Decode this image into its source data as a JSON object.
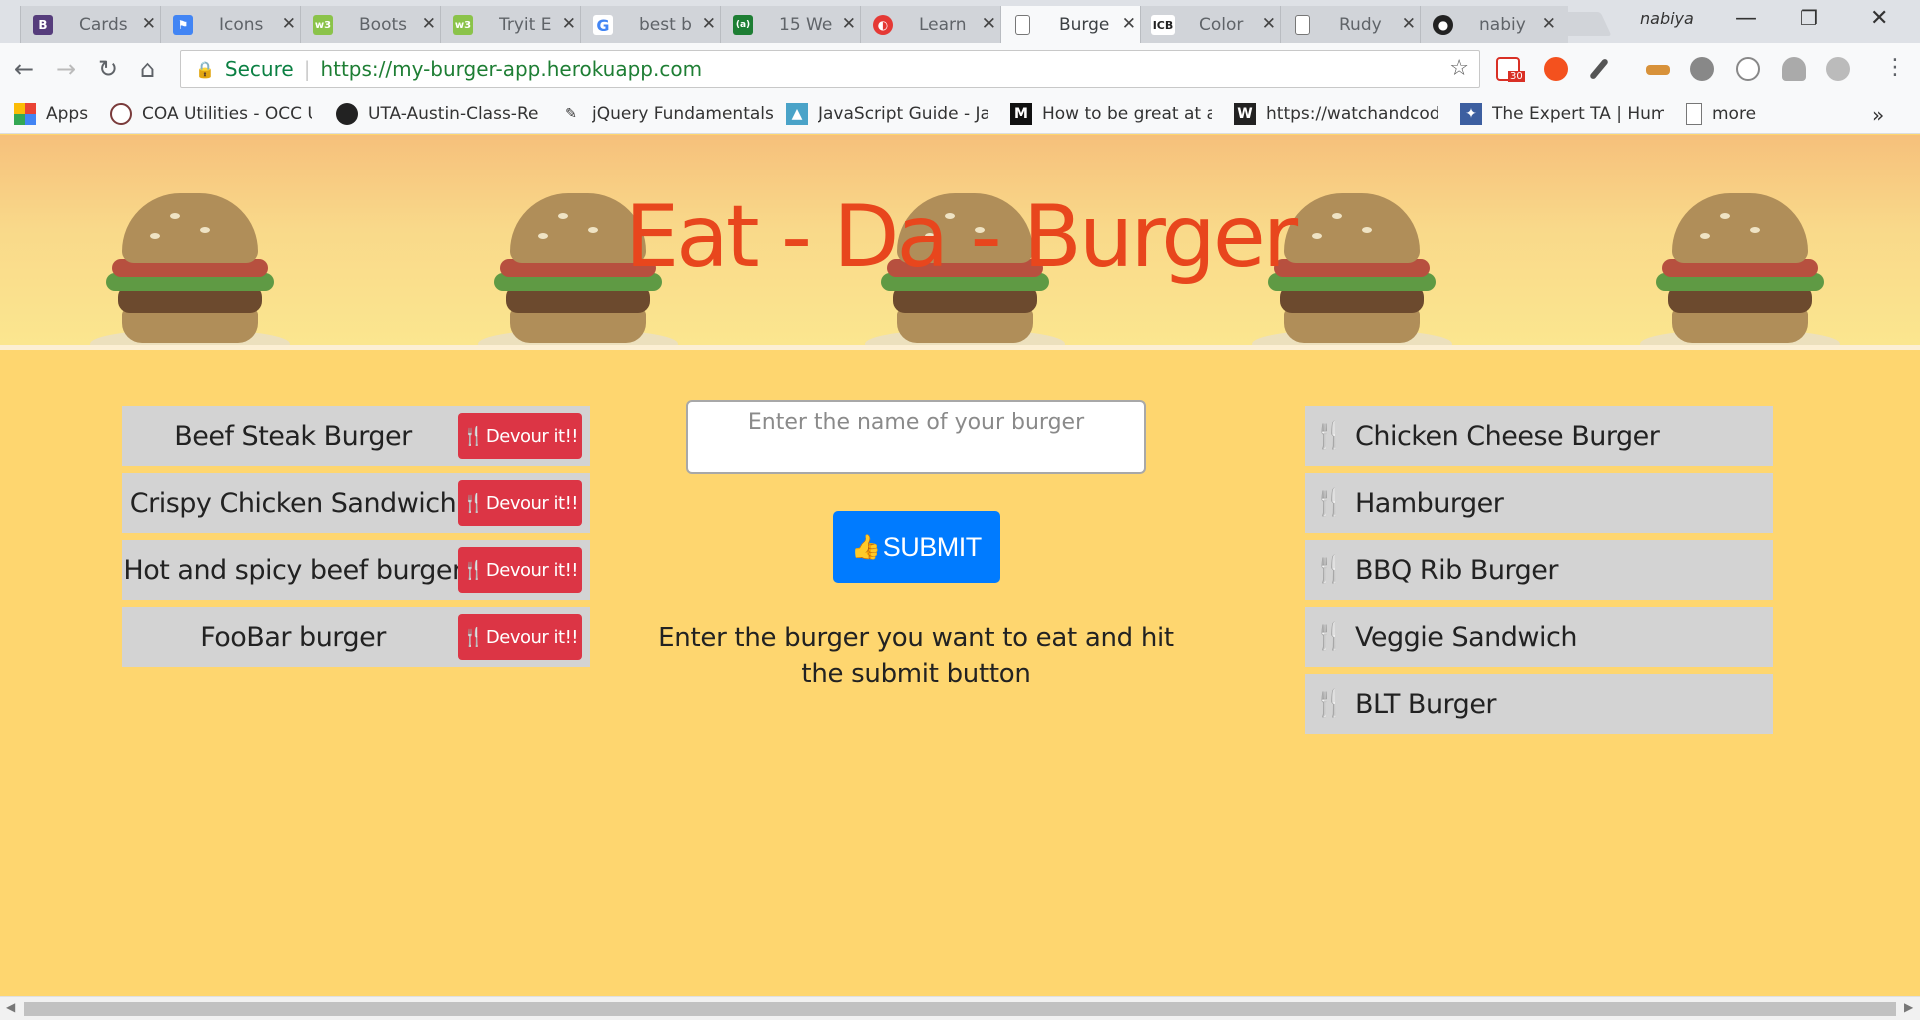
{
  "browser": {
    "tabs": [
      {
        "title": "Cards",
        "icon": "bootstrap-icon",
        "color": "#563d7c",
        "glyph": "B"
      },
      {
        "title": "Icons",
        "icon": "flag-icon",
        "color": "#4285f4",
        "glyph": "⚑"
      },
      {
        "title": "Boots",
        "icon": "w3schools-icon",
        "color": "#8bc34a",
        "glyph": "w3"
      },
      {
        "title": "Tryit E",
        "icon": "w3schools-icon",
        "color": "#8bc34a",
        "glyph": "w3"
      },
      {
        "title": "best b",
        "icon": "google-icon",
        "color": "#4285f4",
        "glyph": "G"
      },
      {
        "title": "15 We",
        "icon": "code-icon",
        "color": "#1e7e34",
        "glyph": "(a)"
      },
      {
        "title": "Learn",
        "icon": "learn-icon",
        "color": "#e53935",
        "glyph": "◐"
      },
      {
        "title": "Burge",
        "icon": "page-icon",
        "color": "#ffffff",
        "glyph": "▯"
      },
      {
        "title": "Color",
        "icon": "icb-icon",
        "color": "#333333",
        "glyph": "ICB"
      },
      {
        "title": "Rudy",
        "icon": "page-icon",
        "color": "#ffffff",
        "glyph": "▯"
      },
      {
        "title": "nabiy",
        "icon": "github-icon",
        "color": "#222222",
        "glyph": "◉"
      }
    ],
    "profile_name": "nabiya",
    "secure_label": "Secure",
    "url": "https://my-burger-app.herokuapp.com",
    "gmail_count": "30",
    "bookmarks": [
      {
        "label": "Apps"
      },
      {
        "label": "COA Utilities - OCC U"
      },
      {
        "label": "UTA-Austin-Class-Re"
      },
      {
        "label": "jQuery Fundamentals"
      },
      {
        "label": "JavaScript Guide - Jav"
      },
      {
        "label": "How to be great at a"
      },
      {
        "label": "https://watchandcod"
      },
      {
        "label": "The Expert TA | Huma"
      },
      {
        "label": "more"
      }
    ],
    "more_chevron": "»"
  },
  "page": {
    "title": "Eat - Da - Burger",
    "devour_label": "Devour it!!",
    "uneaten": [
      "Beef Steak Burger",
      "Crispy Chicken Sandwich",
      "Hot and spicy beef burger",
      "FooBar burger"
    ],
    "input_placeholder": "Enter the name of your burger",
    "submit_label": "SUBMIT",
    "instruction": "Enter the burger you want to eat and hit the submit button",
    "eaten": [
      "Chicken Cheese Burger",
      "Hamburger",
      "BBQ Rib Burger",
      "Veggie Sandwich",
      "BLT Burger"
    ]
  }
}
